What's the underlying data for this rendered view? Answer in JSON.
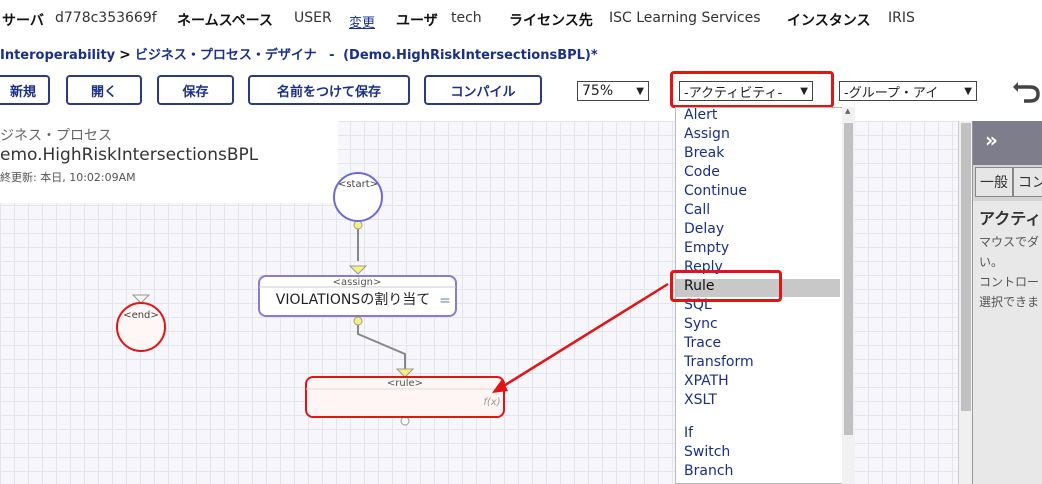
{
  "header": {
    "server_key": "サーバ",
    "server_val": "d778c353669f",
    "namespace_key": "ネームスペース",
    "namespace_val": "USER",
    "change_link": "変更",
    "user_key": "ユーザ",
    "user_val": "tech",
    "license_key": "ライセンス先",
    "license_val": "ISC Learning Services",
    "instance_key": "インスタンス",
    "instance_val": "IRIS"
  },
  "breadcrumb": {
    "root": "Interoperability",
    "sep": ">",
    "page": "ビジネス・プロセス・デザイナ",
    "dash": "-",
    "doc": "(Demo.HighRiskIntersectionsBPL)*"
  },
  "toolbar": {
    "new": "新規",
    "open": "開く",
    "save": "保存",
    "save_as": "名前をつけて保存",
    "compile": "コンパイル",
    "zoom": "75%",
    "activity": "-アクティビティ-",
    "group": "-グループ・アイ"
  },
  "process": {
    "label": "ジネス・プロセス",
    "name": "emo.HighRiskIntersectionsBPL",
    "updated": "終更新: 本日, 10:02:09AM"
  },
  "diagram": {
    "start": "<start>",
    "end": "<end>",
    "assign_tag": "<assign>",
    "assign_text": "VIOLATIONSの割り当て",
    "assign_icon": "=",
    "rule_tag": "<rule>",
    "rule_fx": "f(x)"
  },
  "activity_menu": [
    "Alert",
    "Assign",
    "Break",
    "Code",
    "Continue",
    "Call",
    "Delay",
    "Empty",
    "Reply",
    "Rule",
    "SQL",
    "Sync",
    "Trace",
    "Transform",
    "XPATH",
    "XSLT",
    "",
    "If",
    "Switch",
    "Branch"
  ],
  "highlighted_item": "Rule",
  "right_panel": {
    "collapse_icon": "»",
    "tab_general": "一般",
    "tab_other": "コン",
    "title": "アクティ",
    "line1": "マウスでダ",
    "line2": "い。",
    "line3": "コントロー",
    "line4": "選択できま"
  },
  "colors": {
    "accent": "#1a2f8a",
    "highlight": "#e31414",
    "rule_fill": "#fff5f5"
  }
}
